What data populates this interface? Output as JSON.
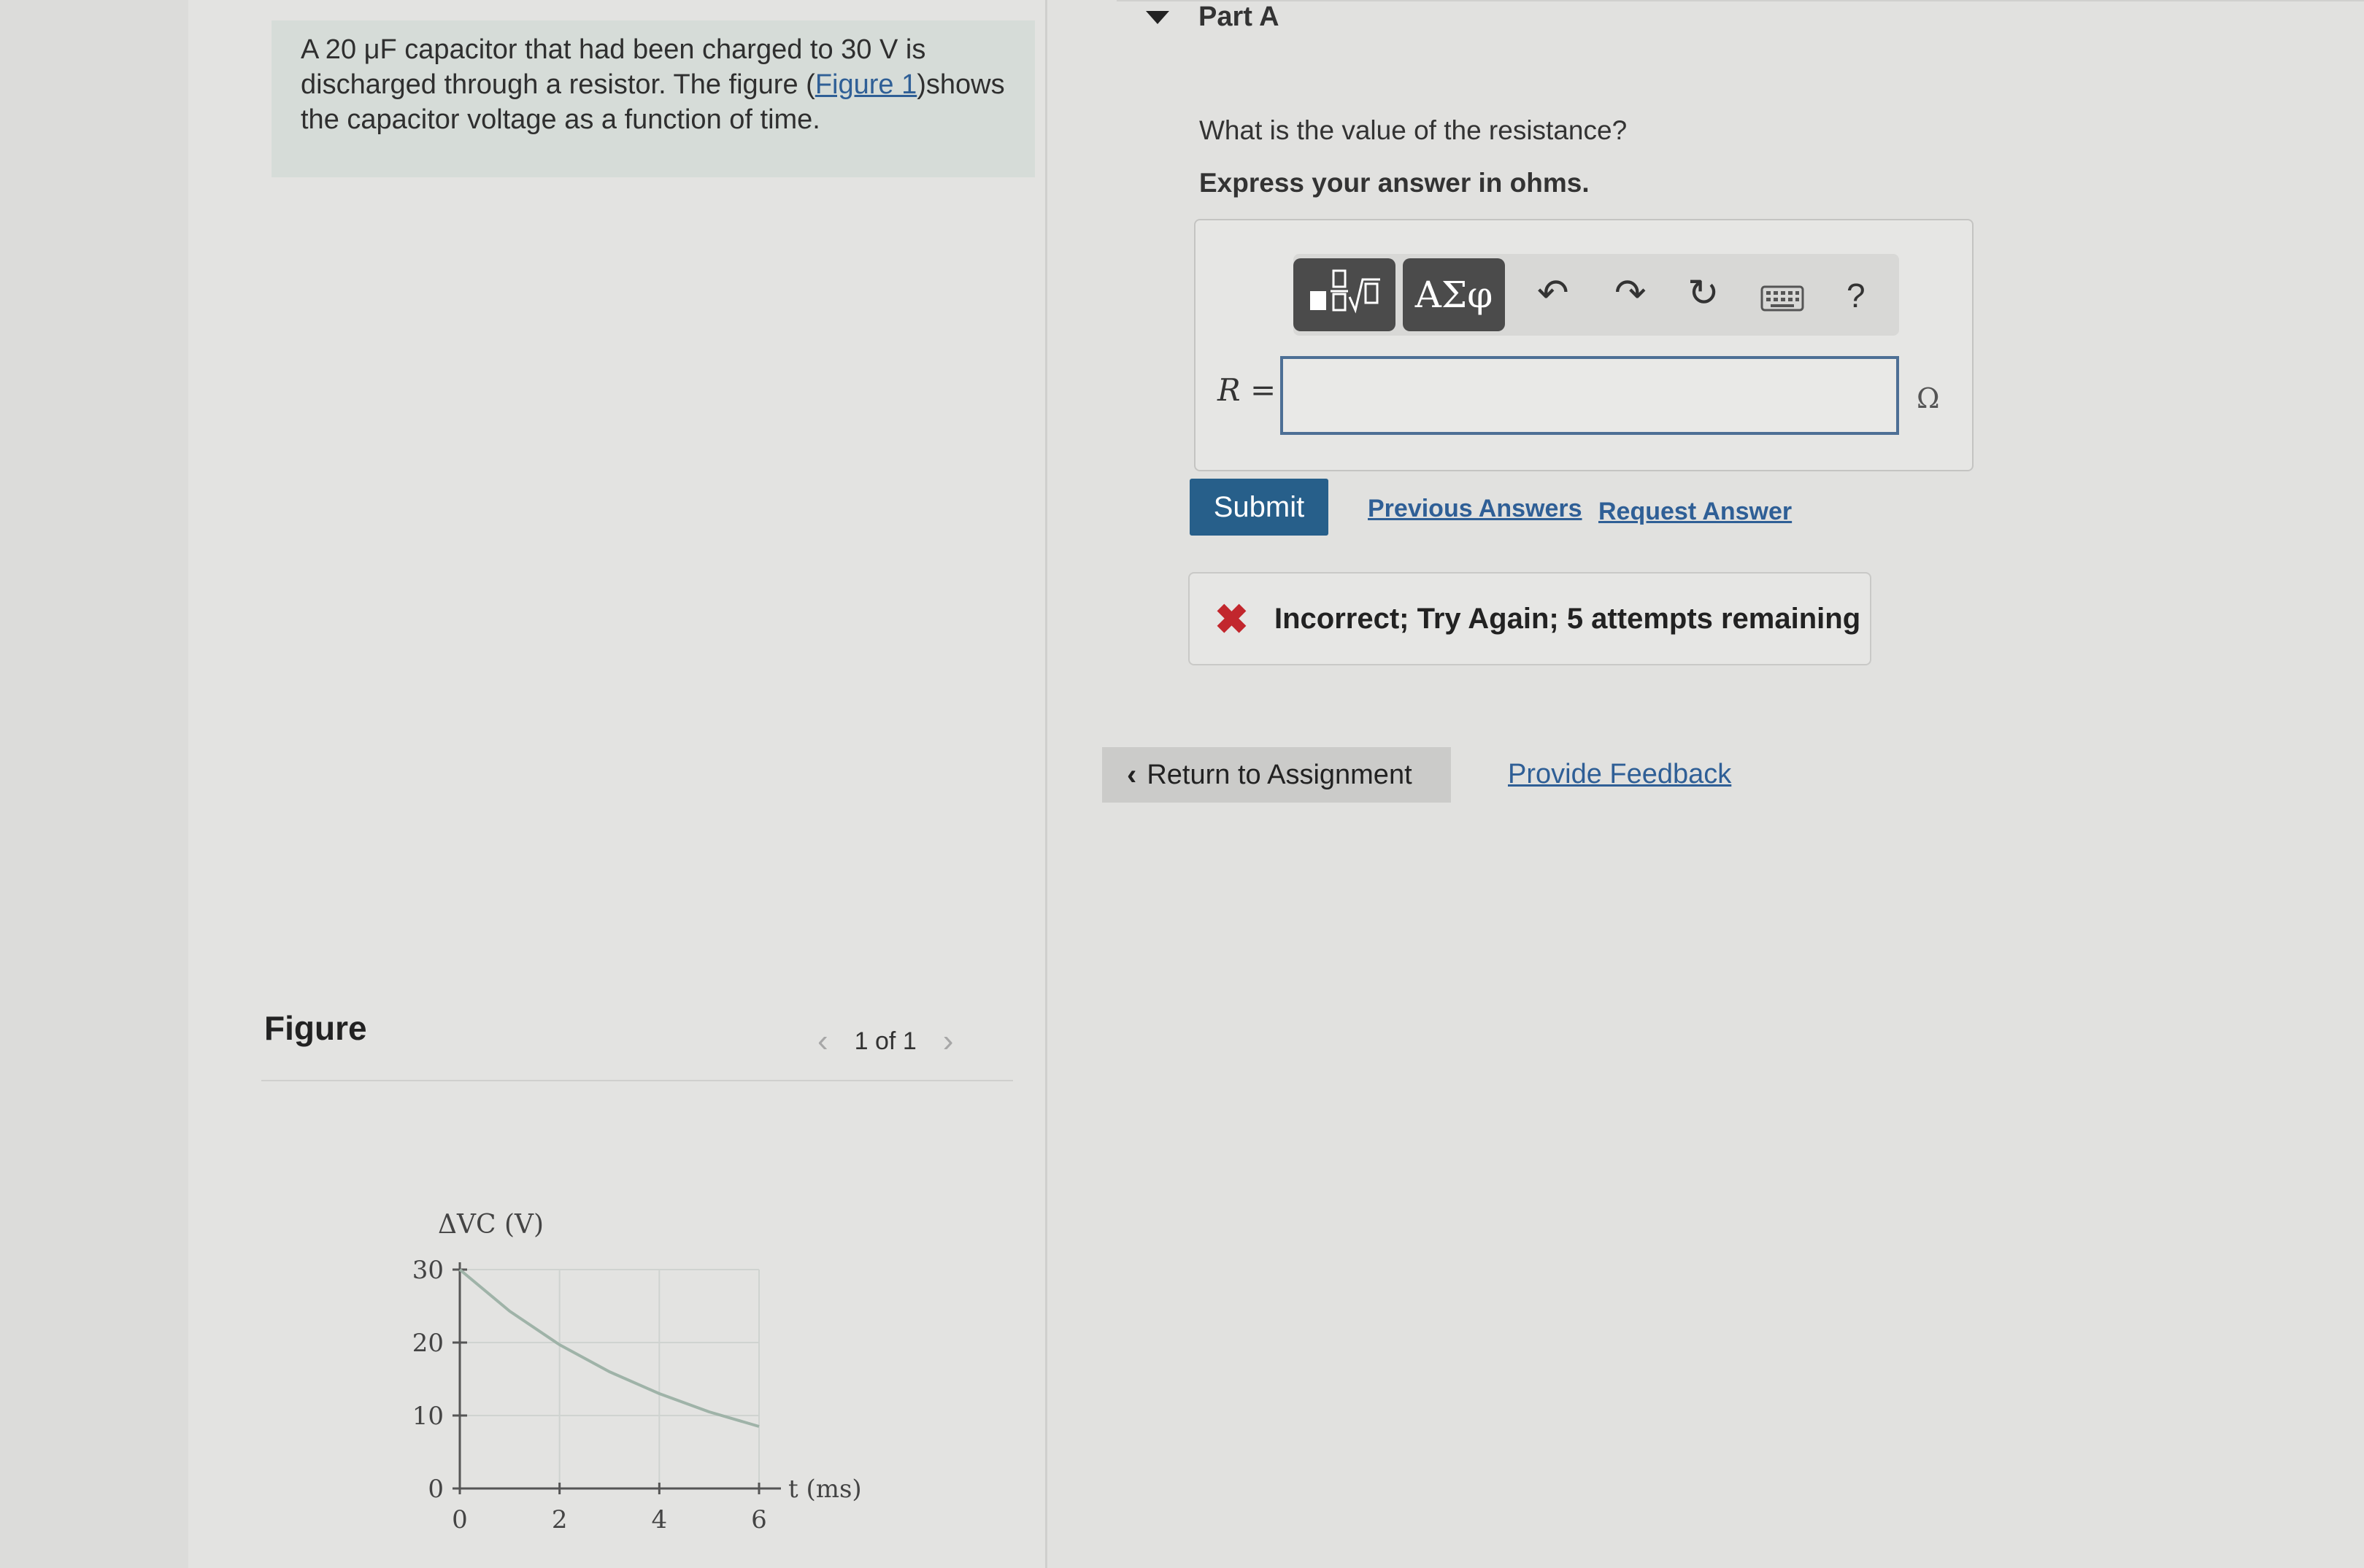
{
  "problem": {
    "text_before": "A 20 μF capacitor that had been charged to 30 V is discharged through a resistor. The figure (",
    "figure_link": "Figure 1",
    "text_after": ")shows the capacitor voltage as a function of time."
  },
  "figure": {
    "title": "Figure",
    "pager": "1 of 1",
    "prev_icon": "chevron-left-icon",
    "next_icon": "chevron-right-icon"
  },
  "chart_data": {
    "type": "line",
    "ylabel": "ΔVC (V)",
    "xlabel": "t (ms)",
    "xlim": [
      0,
      6
    ],
    "ylim": [
      0,
      30
    ],
    "x_ticks": [
      "0",
      "2",
      "4",
      "6"
    ],
    "y_ticks": [
      "0",
      "10",
      "20",
      "30"
    ],
    "grid": true,
    "series": [
      {
        "color": "#9fb3a8",
        "points": [
          [
            0,
            30
          ],
          [
            1,
            24.3
          ],
          [
            2,
            19.7
          ],
          [
            3,
            16.0
          ],
          [
            4,
            13.0
          ],
          [
            5,
            10.5
          ],
          [
            6,
            8.5
          ]
        ]
      }
    ]
  },
  "part": {
    "title": "Part A",
    "collapse_icon": "triangle-down-icon",
    "question": "What is the value of the resistance?",
    "instruction": "Express your answer in ohms.",
    "toolbar": {
      "templates_icon": "fraction-root-icon",
      "symbols_label": "ΑΣφ",
      "undo_icon": "undo-icon",
      "redo_icon": "redo-icon",
      "reset_icon": "refresh-icon",
      "keyboard_icon": "keyboard-icon",
      "help_label": "?"
    },
    "answer_label": "R =",
    "answer_value": "",
    "unit": "Ω"
  },
  "actions": {
    "submit": "Submit",
    "previous_answers": "Previous Answers",
    "request_answer": "Request Answer"
  },
  "feedback": {
    "message": "Incorrect; Try Again; 5 attempts remaining",
    "status_color": "#c2272d"
  },
  "footer": {
    "return_label": "Return to Assignment",
    "provide_feedback": "Provide Feedback"
  }
}
